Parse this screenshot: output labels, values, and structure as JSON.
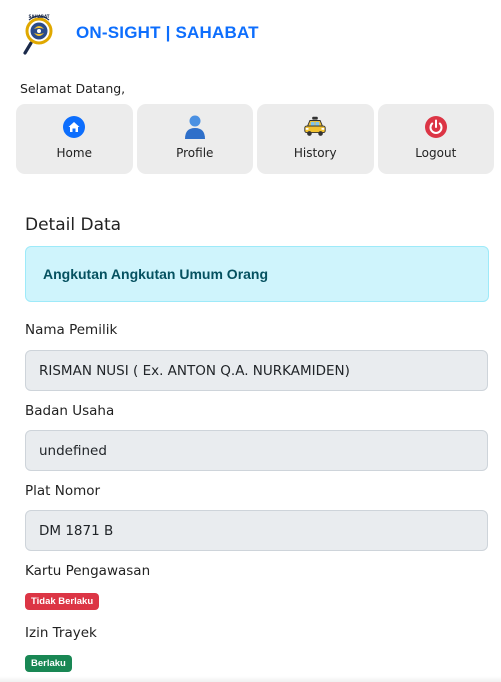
{
  "header": {
    "brand_title": "ON-SIGHT | SAHABAT",
    "logo_text": "SAHABAT",
    "welcome": "Selamat Datang,"
  },
  "nav": [
    {
      "label": "Home",
      "icon": "home-icon",
      "color": "#0d6efd"
    },
    {
      "label": "Profile",
      "icon": "user-icon",
      "color": "#4a90e2"
    },
    {
      "label": "History",
      "icon": "taxi-icon",
      "color": "#e5b100"
    },
    {
      "label": "Logout",
      "icon": "power-icon",
      "color": "#dc3545"
    }
  ],
  "detail": {
    "title": "Detail Data",
    "category": "Angkutan Angkutan Umum Orang",
    "fields": [
      {
        "label": "Nama Pemilik",
        "value": "RISMAN NUSI ( Ex. ANTON Q.A. NURKAMIDEN)"
      },
      {
        "label": "Badan Usaha",
        "value": "undefined"
      },
      {
        "label": "Plat Nomor",
        "value": "DM 1871 B"
      }
    ],
    "statuses": [
      {
        "label": "Kartu Pengawasan",
        "badge": "Tidak Berlaku",
        "color": "#dc3545"
      },
      {
        "label": "Izin Trayek",
        "badge": "Berlaku",
        "color": "#198754"
      }
    ]
  }
}
